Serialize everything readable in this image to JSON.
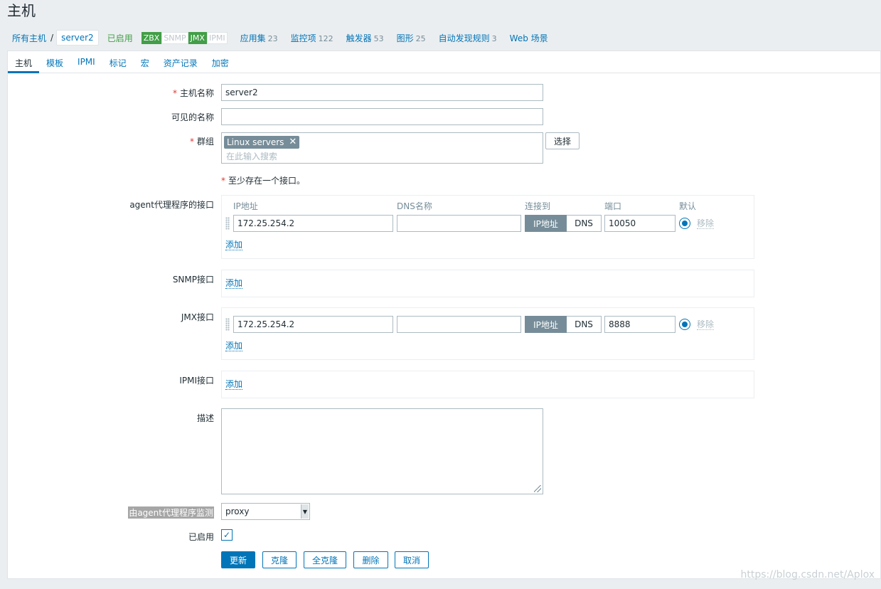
{
  "page_title": "主机",
  "breadcrumb": {
    "all_hosts": "所有主机",
    "separator": "/",
    "current": "server2"
  },
  "host_status": "已启用",
  "availability": [
    "ZBX",
    "SNMP",
    "JMX",
    "IPMI"
  ],
  "app_nav": [
    {
      "label": "应用集",
      "count": "23"
    },
    {
      "label": "监控项",
      "count": "122"
    },
    {
      "label": "触发器",
      "count": "53"
    },
    {
      "label": "图形",
      "count": "25"
    },
    {
      "label": "自动发现规则",
      "count": "3"
    },
    {
      "label": "Web 场景",
      "count": ""
    }
  ],
  "tabs": [
    "主机",
    "模板",
    "IPMI",
    "标记",
    "宏",
    "资产记录",
    "加密"
  ],
  "form": {
    "host_name_label": "主机名称",
    "host_name_value": "server2",
    "visible_name_label": "可见的名称",
    "visible_name_value": "",
    "groups_label": "群组",
    "group_tag": "Linux servers",
    "group_placeholder": "在此输入搜索",
    "select_button": "选择",
    "interface_note": "至少存在一个接口。",
    "agent_label": "agent代理程序的接口",
    "snmp_label": "SNMP接口",
    "jmx_label": "JMX接口",
    "ipmi_label": "IPMI接口",
    "columns": {
      "ip": "IP地址",
      "dns": "DNS名称",
      "connect": "连接到",
      "port": "端口",
      "default": "默认"
    },
    "agent_interface": {
      "ip": "172.25.254.2",
      "dns": "",
      "connect_ip": "IP地址",
      "connect_dns": "DNS",
      "port": "10050",
      "remove": "移除"
    },
    "jmx_interface": {
      "ip": "172.25.254.2",
      "dns": "",
      "connect_ip": "IP地址",
      "connect_dns": "DNS",
      "port": "8888",
      "remove": "移除"
    },
    "add_link": "添加",
    "description_label": "描述",
    "description_value": "",
    "proxy_label": "由agent代理程序监测",
    "proxy_value": "proxy",
    "enabled_label": "已启用",
    "enabled": true
  },
  "buttons": {
    "update": "更新",
    "clone": "克隆",
    "full_clone": "全克隆",
    "delete": "删除",
    "cancel": "取消"
  },
  "watermark": "https://blog.csdn.net/Aplox"
}
